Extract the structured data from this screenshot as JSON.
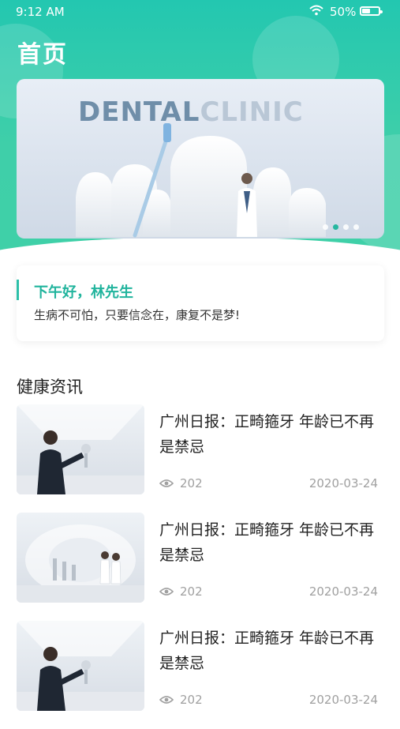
{
  "status_bar": {
    "time": "9:12 AM",
    "battery_percent": "50%",
    "battery_level": 0.5
  },
  "header": {
    "title": "首页"
  },
  "banner": {
    "text_dark": "DENTAL",
    "text_light": "CLINIC",
    "dots_count": 4,
    "active_dot": 1
  },
  "greeting": {
    "title": "下午好，林先生",
    "subtitle": "生病不可怕，只要信念在，康复不是梦!"
  },
  "news": {
    "section_title": "健康资讯",
    "items": [
      {
        "title": "广州日报：正畸箍牙 年龄已不再是禁忌",
        "views": "202",
        "date": "2020-03-24"
      },
      {
        "title": "广州日报：正畸箍牙 年龄已不再是禁忌",
        "views": "202",
        "date": "2020-03-24"
      },
      {
        "title": "广州日报：正畸箍牙 年龄已不再是禁忌",
        "views": "202",
        "date": "2020-03-24"
      }
    ]
  },
  "colors": {
    "accent": "#2cbfa8",
    "header_green": "#3fcfa9",
    "muted": "#a0a0a0"
  }
}
